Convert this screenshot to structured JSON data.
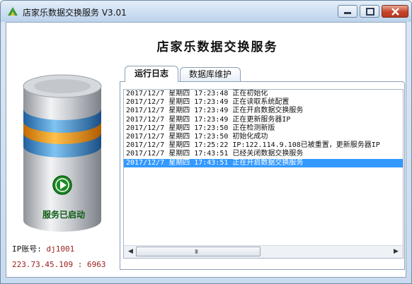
{
  "window": {
    "title": "店家乐数据交换服务 V3.01",
    "controls": {
      "minimize": "minimize",
      "maximize": "maximize",
      "close": "close"
    }
  },
  "header": {
    "app_title": "店家乐数据交换服务"
  },
  "status": {
    "label": "服务已启动",
    "icon": "play-icon",
    "color": "#1e8a25"
  },
  "connection": {
    "ip_account_label": "IP账号:",
    "ip_account_value": "dj1001",
    "address": "223.73.45.109 : 6963"
  },
  "tabs": [
    {
      "label": "运行日志",
      "active": true
    },
    {
      "label": "数据库维护",
      "active": false
    }
  ],
  "log": {
    "entries": [
      "2017/12/7 星期四 17:23:48 正在初始化",
      "2017/12/7 星期四 17:23:49 正在读取系统配置",
      "2017/12/7 星期四 17:23:49 正在开启数据交换服务",
      "2017/12/7 星期四 17:23:49 正在更新服务器IP",
      "2017/12/7 星期四 17:23:50 正在检测新版",
      "2017/12/7 星期四 17:23:50 初始化成功",
      "2017/12/7 星期四 17:25:22 IP:122.114.9.108已被重置，更新服务器IP",
      "2017/12/7 星期四 17:43:51 已经关闭数据交换服务",
      "2017/12/7 星期四 17:43:51 正在开启数据交换服务"
    ],
    "selected_index": 8,
    "selection_color": "#3399ff"
  },
  "scrollbar": {
    "left_arrow": "◀",
    "right_arrow": "▶",
    "grip": "III"
  }
}
